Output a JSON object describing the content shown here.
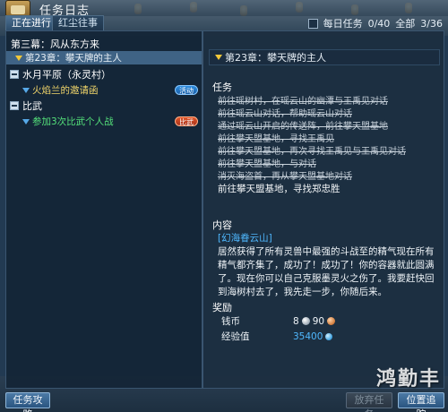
{
  "window": {
    "title": "任务日志"
  },
  "top_right": {
    "daily_label": "每日任务",
    "daily_count": "0/40",
    "all_label": "全部",
    "all_count": "3/36"
  },
  "tabs": [
    {
      "label": "正在进行",
      "active": true
    },
    {
      "label": "红尘往事",
      "active": false
    }
  ],
  "left_list": {
    "chapter_title": "第三幕：风从东方来",
    "items": [
      {
        "type": "quest",
        "label": "第23章：攀天牌的主人",
        "color": "yellow",
        "selected": true
      },
      {
        "type": "group",
        "label": "水月平原（永灵村）"
      },
      {
        "type": "quest",
        "label": "火焰兰的邀请函",
        "color": "yellow",
        "badge": "活动",
        "badge_color": "blue"
      },
      {
        "type": "group",
        "label": "比武"
      },
      {
        "type": "quest",
        "label": "参加3次比武个人战",
        "color": "green",
        "badge": "比武",
        "badge_color": "red"
      }
    ]
  },
  "detail": {
    "header": "第23章：攀天牌的主人",
    "task_label": "任务",
    "tasks_done": [
      "前往瑶树村，在瑶云山的幽潭与王禹见对话",
      "前往瑶云山对话，帮助瑶云山对话",
      "通过瑶云山开启的传送阵，前往攀天盟基地",
      "前往攀天盟基地，寻找王禹见",
      "前往攀天盟基地，再次寻找王禹见与王禹见对话",
      "前往攀天盟基地，与对话",
      "消灭海盗首，再从攀天盟基地对话"
    ],
    "task_current": "前往攀天盟基地，寻找郑忠胜",
    "content_label": "内容",
    "content_place": "[幻海眷云山]",
    "content_text": "居然获得了所有灵兽中最强的斗战至的精气现在所有精气都齐集了，成功了！成功了！你的容器就此圆满了。现在你可以自己克服墨灵火之伤了。我要赶快回到海树村去了，我先走一步，你随后来。",
    "reward_label": "奖励",
    "money_label": "钱币",
    "money_silver": "8",
    "money_copper": "90",
    "exp_label": "经验值",
    "exp_value": "35400"
  },
  "buttons": {
    "guide": "任务攻略",
    "abandon": "放弃任务",
    "track": "位置追踪"
  },
  "watermark": "鸿勤丰"
}
